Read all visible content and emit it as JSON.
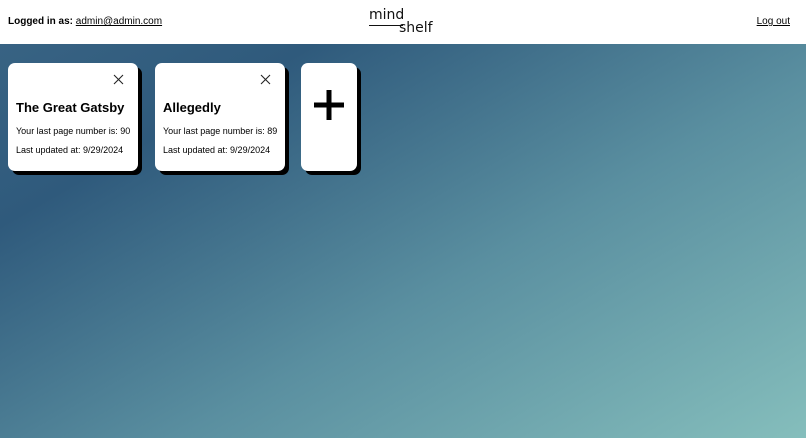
{
  "header": {
    "login_label": "Logged in as:",
    "user_email": "admin@admin.com",
    "logo_top": "mind",
    "logo_bottom": "shelf",
    "logout_label": "Log out"
  },
  "books": [
    {
      "title": "The Great Gatsby",
      "last_page": "Your last page number is: 90",
      "last_updated": "Last updated at: 9/29/2024"
    },
    {
      "title": "Allegedly",
      "last_page": "Your last page number is: 89",
      "last_updated": "Last updated at: 9/29/2024"
    }
  ],
  "icons": {
    "close": "close-icon",
    "add": "plus-icon"
  }
}
